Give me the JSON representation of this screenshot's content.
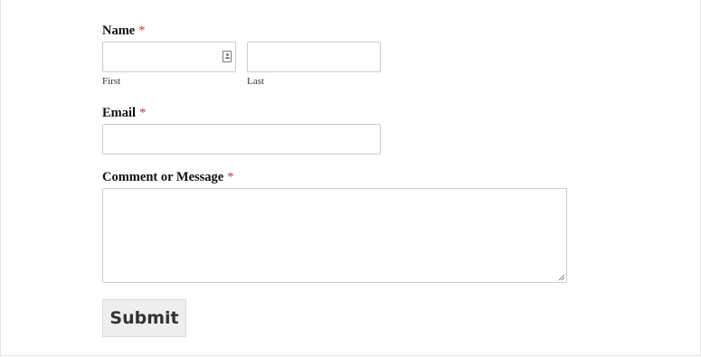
{
  "form": {
    "name": {
      "label": "Name",
      "required_marker": "*",
      "first": {
        "value": "",
        "sublabel": "First"
      },
      "last": {
        "value": "",
        "sublabel": "Last"
      }
    },
    "email": {
      "label": "Email",
      "required_marker": "*",
      "value": ""
    },
    "message": {
      "label": "Comment or Message",
      "required_marker": "*",
      "value": ""
    },
    "submit_label": "Submit"
  },
  "colors": {
    "required": "#d63638",
    "input_border": "#cccccc",
    "button_bg": "#eeeeee",
    "button_text": "#333333"
  },
  "icons": {
    "autofill": "contact-card-icon",
    "resize": "resize-handle-icon"
  }
}
